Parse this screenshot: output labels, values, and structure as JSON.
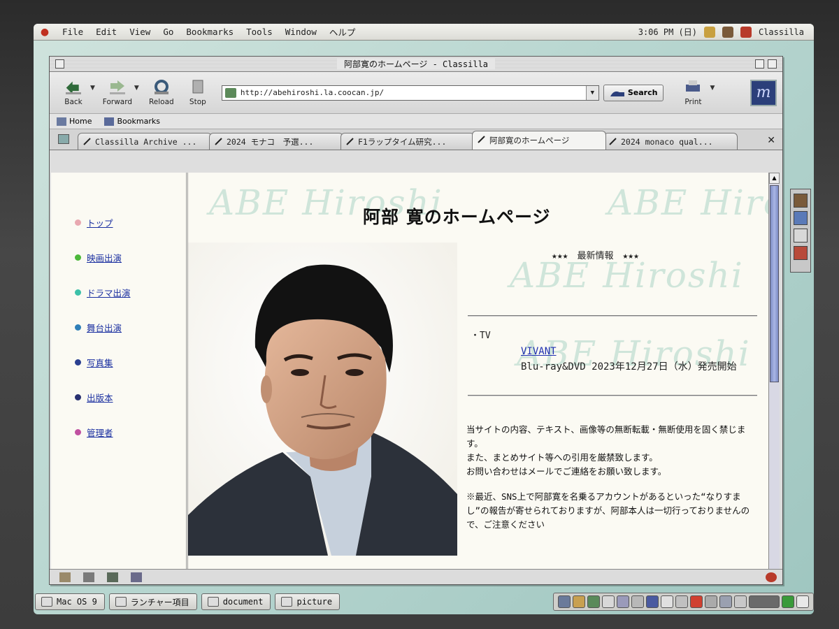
{
  "menubar": {
    "items": [
      "File",
      "Edit",
      "View",
      "Go",
      "Bookmarks",
      "Tools",
      "Window",
      "ヘルプ"
    ],
    "clock": "3:06 PM (日)",
    "app_name": "Classilla"
  },
  "window": {
    "title": "阿部寛のホームページ - Classilla"
  },
  "toolbar": {
    "back_label": "Back",
    "forward_label": "Forward",
    "reload_label": "Reload",
    "stop_label": "Stop",
    "url": "http://abehiroshi.la.coocan.jp/",
    "search_label": "Search",
    "print_label": "Print"
  },
  "personal_bar": {
    "home_label": "Home",
    "bookmarks_label": "Bookmarks"
  },
  "tabs": [
    {
      "label": "Classilla Archive ..."
    },
    {
      "label": "2024 モナコ　予選..."
    },
    {
      "label": "F1ラップタイム研究..."
    },
    {
      "label": "阿部寛のホームページ",
      "active": true
    },
    {
      "label": "2024 monaco qual..."
    }
  ],
  "sidebar": {
    "items": [
      {
        "label": "トップ",
        "color": "#e8a8b0"
      },
      {
        "label": "映画出演",
        "color": "#4cb83a"
      },
      {
        "label": "ドラマ出演",
        "color": "#3cc0a8"
      },
      {
        "label": "舞台出演",
        "color": "#2f7fb8"
      },
      {
        "label": "写真集",
        "color": "#2a3f90"
      },
      {
        "label": "出版本",
        "color": "#283070"
      },
      {
        "label": "管理者",
        "color": "#c050a0"
      }
    ]
  },
  "main": {
    "watermark": "ABE Hiroshi",
    "title": "阿部 寛のホームページ",
    "latest_news": "★★★　最新情報　★★★",
    "tv_label": "・TV",
    "vivant_link": "VIVANT",
    "release_text": "Blu-ray&DVD 2023年12月27日（水）発売開始",
    "notice": [
      "当サイトの内容、テキスト、画像等の無断転載・無断使用を固く禁じます。",
      "また、まとめサイト等への引用を厳禁致します。",
      "お問い合わせはメールでご連絡をお願い致します。"
    ],
    "warning": "※最近、SNS上で阿部寛を名乗るアカウントがあるといった“なりすまし”の報告が寄せられておりますが、阿部本人は一切行っておりませんので、ご注意ください"
  },
  "taskbar": {
    "items": [
      "Mac OS 9",
      "ランチャー項目",
      "document",
      "picture"
    ]
  }
}
